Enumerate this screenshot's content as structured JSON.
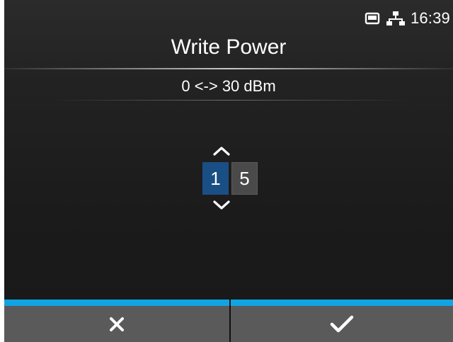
{
  "status": {
    "time": "16:39",
    "icons": [
      "sd-card-icon",
      "network-icon"
    ]
  },
  "header": {
    "title": "Write Power",
    "range": "0 <-> 30 dBm"
  },
  "stepper": {
    "digits": [
      "1",
      "5"
    ],
    "active_index": 0,
    "up_icon": "chevron-up-icon",
    "down_icon": "chevron-down-icon"
  },
  "buttons": {
    "cancel_icon": "close-icon",
    "ok_icon": "checkmark-icon"
  },
  "colors": {
    "accent": "#11a4e2",
    "digit_active": "#1a4f86",
    "digit_inactive": "#4a4a4a",
    "button_bg": "#5a5a5a"
  }
}
